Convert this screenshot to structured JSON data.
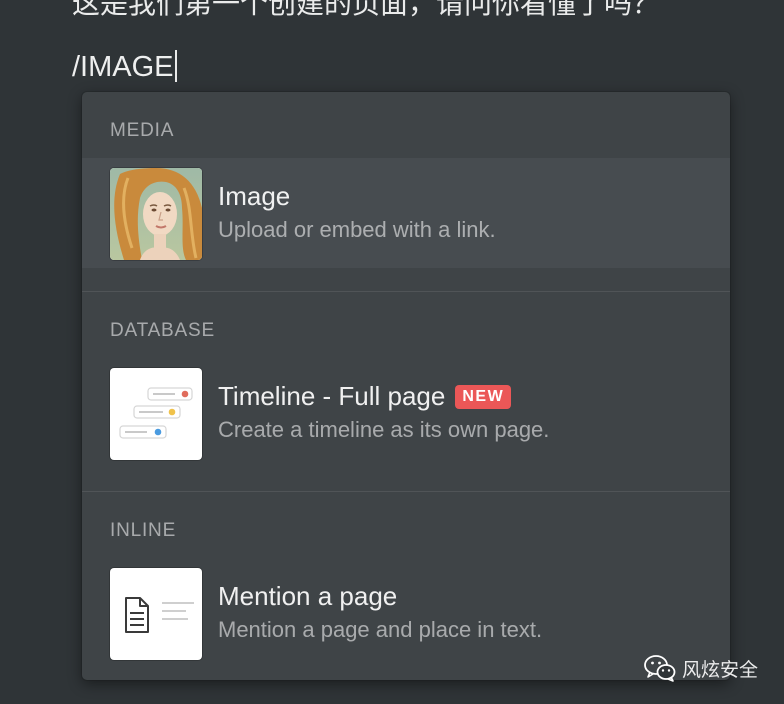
{
  "editor": {
    "previous_line": "这是我们第一个创建的页面，请问你看懂了吗？",
    "command_text": "/IMAGE"
  },
  "menu": {
    "sections": [
      {
        "header": "MEDIA",
        "item": {
          "title": "Image",
          "description": "Upload or embed with a link.",
          "icon": "image-thumbnail-icon",
          "selected": true
        }
      },
      {
        "header": "DATABASE",
        "item": {
          "title": "Timeline - Full page",
          "badge": "NEW",
          "description": "Create a timeline as its own page.",
          "icon": "timeline-icon"
        }
      },
      {
        "header": "INLINE",
        "item": {
          "title": "Mention a page",
          "description": "Mention a page and place in text.",
          "icon": "mention-page-icon"
        }
      }
    ]
  },
  "watermark": {
    "text": "风炫安全",
    "icon": "wechat-icon"
  },
  "colors": {
    "background": "#2f3437",
    "menu_background": "#3f4447",
    "selected_row": "#474c50",
    "badge": "#eb5757",
    "timeline_dots": [
      "#e06c5c",
      "#f0c24b",
      "#4a9be0"
    ]
  }
}
